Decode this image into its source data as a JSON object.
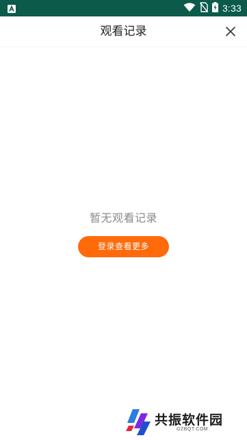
{
  "status_bar": {
    "time": "3:33",
    "icons": [
      "app-notification-icon",
      "wifi-icon",
      "no-sim-icon",
      "battery-charging-icon"
    ]
  },
  "header": {
    "title": "观看记录",
    "close_icon": "close-icon"
  },
  "empty_state": {
    "message": "暂无观看记录",
    "login_button_label": "登录查看更多"
  },
  "watermark": {
    "brand": "共振软件园",
    "domain": "GZBQT.COM"
  },
  "colors": {
    "status_bar_bg": "#0b5a4a",
    "accent": "#ff6a0a",
    "title_text": "#222222",
    "empty_text": "#8a8a8a"
  }
}
